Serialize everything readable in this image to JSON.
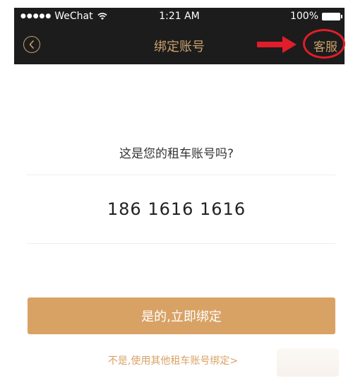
{
  "status_bar": {
    "carrier": "WeChat",
    "signal_dots": "●●●●●",
    "time": "1:21 AM",
    "battery": "100%",
    "wifi_icon": "wifi-icon",
    "battery_icon": "battery-icon"
  },
  "nav": {
    "back_icon": "chevron-left-icon",
    "title": "绑定账号",
    "service_label": "客服"
  },
  "main": {
    "question": "这是您的租车账号吗?",
    "account_number": "186 1616 1616",
    "confirm_button": "是的,立即绑定",
    "alt_link": "不是,使用其他租车账号绑定>"
  },
  "colors": {
    "header_background": "#1c1c1c",
    "accent_gold": "#c9a06b",
    "button_background": "#d9a265",
    "annotation_red": "#e01d2a"
  }
}
